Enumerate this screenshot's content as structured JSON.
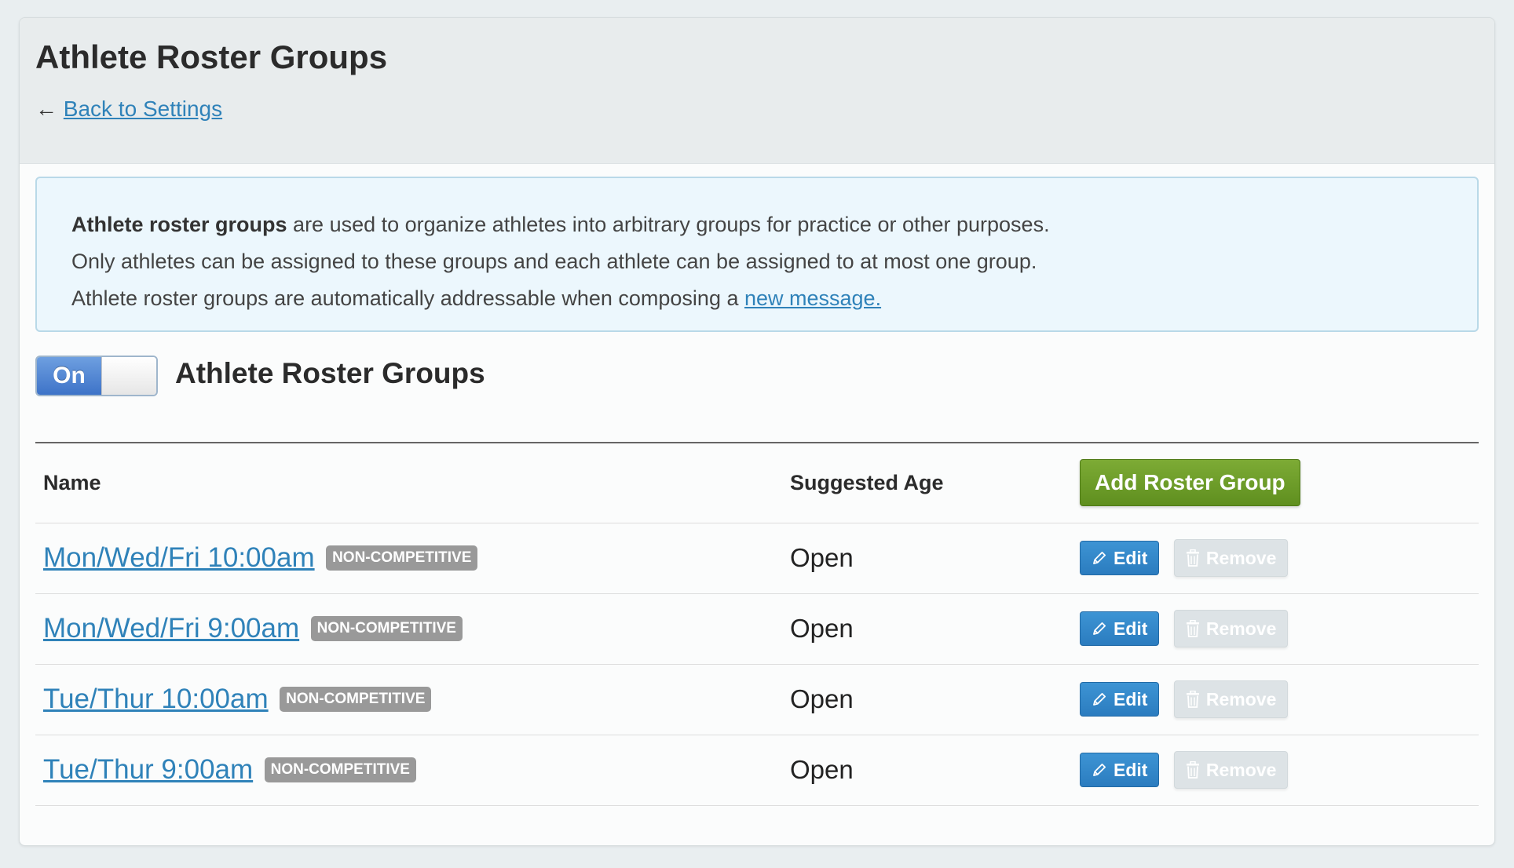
{
  "header": {
    "title": "Athlete Roster Groups",
    "back_arrow": "←",
    "back_link": "Back to Settings"
  },
  "info": {
    "line1_bold": "Athlete roster groups",
    "line1_rest": " are used to organize athletes into arbitrary groups for practice or other purposes.",
    "line2": "Only athletes can be assigned to these groups and each athlete can be assigned to at most one group.",
    "line3_prefix": "Athlete roster groups are automatically addressable when composing a ",
    "line3_link": "new message."
  },
  "toggle": {
    "state_label": "On",
    "label": "Athlete Roster Groups"
  },
  "table": {
    "headers": {
      "name": "Name",
      "age": "Suggested Age"
    },
    "add_button": "Add Roster Group",
    "edit_label": "Edit",
    "remove_label": "Remove",
    "rows": [
      {
        "name": "Mon/Wed/Fri 10:00am",
        "badge": "NON-COMPETITIVE",
        "age": "Open"
      },
      {
        "name": "Mon/Wed/Fri 9:00am",
        "badge": "NON-COMPETITIVE",
        "age": "Open"
      },
      {
        "name": "Tue/Thur 10:00am",
        "badge": "NON-COMPETITIVE",
        "age": "Open"
      },
      {
        "name": "Tue/Thur 9:00am",
        "badge": "NON-COMPETITIVE",
        "age": "Open"
      }
    ]
  },
  "icons": {
    "edit": "pencil-icon",
    "remove": "trash-icon"
  },
  "colors": {
    "link": "#2f82b9",
    "add_button": "#6c9c28",
    "edit_button": "#3488c9",
    "badge": "#999999",
    "toggle_on": "#4f86d6"
  }
}
